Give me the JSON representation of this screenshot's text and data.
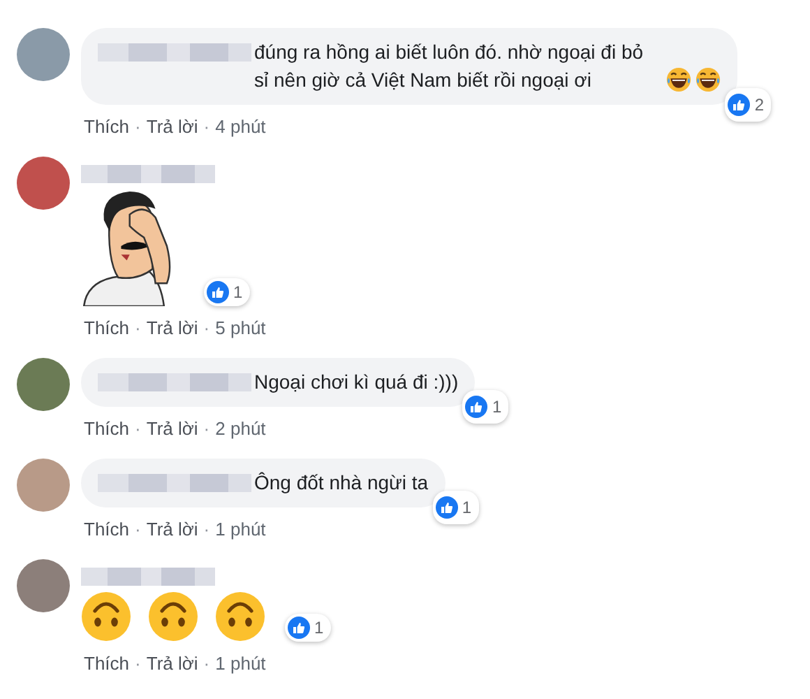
{
  "separator": "·",
  "comments": [
    {
      "kind": "text",
      "text": "đúng ra hồng ai biết luôn đó. nhờ ngoại đi bỏ sỉ nên giờ cả Việt Nam biết rồi ngoại ơi",
      "trailing_emoji": [
        {
          "kind": "laughing"
        },
        {
          "kind": "laughing"
        }
      ],
      "likes": "2",
      "like_label": "Thích",
      "reply_label": "Trả lời",
      "time": "4 phút"
    },
    {
      "kind": "sticker",
      "likes": "1",
      "like_label": "Thích",
      "reply_label": "Trả lời",
      "time": "5 phút"
    },
    {
      "kind": "text",
      "text": "Ngoại chơi kì quá đi :)))",
      "likes": "1",
      "like_label": "Thích",
      "reply_label": "Trả lời",
      "time": "2 phút"
    },
    {
      "kind": "text",
      "text": "Ông đốt nhà ngừi ta",
      "likes": "1",
      "like_label": "Thích",
      "reply_label": "Trả lời",
      "time": "1 phút"
    },
    {
      "kind": "emoji",
      "emoji": [
        {
          "kind": "upside-down"
        },
        {
          "kind": "upside-down"
        },
        {
          "kind": "upside-down"
        }
      ],
      "likes": "1",
      "like_label": "Thích",
      "reply_label": "Trả lời",
      "time": "1 phút"
    }
  ]
}
